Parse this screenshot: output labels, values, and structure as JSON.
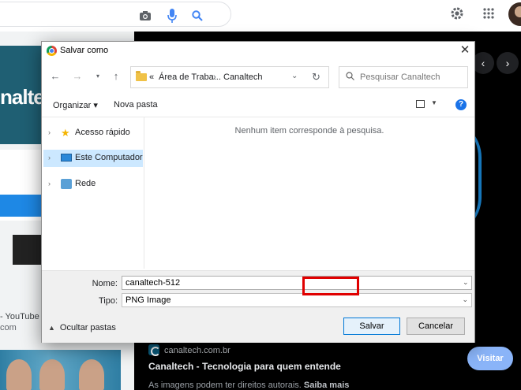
{
  "browser": {
    "left_caption_1": "- YouTube",
    "left_caption_2": "com",
    "tile_brand_text": "nalte"
  },
  "result": {
    "site_domain": "canaltech.com.br",
    "site_title": "Canaltech - Tecnologia para quem entende",
    "note_text": "As imagens podem ter direitos autorais.",
    "note_link": "Saiba mais",
    "visit_label": "Visitar"
  },
  "dialog": {
    "title": "Salvar como",
    "breadcrumb": {
      "overflow": "«",
      "items": [
        "Área de Traba...",
        "Canaltech"
      ]
    },
    "search_placeholder": "Pesquisar Canaltech",
    "toolbar": {
      "organize_label": "Organizar ▾",
      "new_folder_label": "Nova pasta"
    },
    "tree": [
      {
        "label": "Acesso rápido",
        "icon": "star-icon"
      },
      {
        "label": "Este Computador",
        "icon": "computer-icon",
        "selected": true
      },
      {
        "label": "Rede",
        "icon": "network-icon"
      }
    ],
    "empty_message": "Nenhum item corresponde à pesquisa.",
    "filename_label": "Nome:",
    "filename_value": "canaltech-512",
    "filetype_label": "Tipo:",
    "filetype_value": "PNG Image",
    "hide_folders_label": "Ocultar pastas",
    "save_label": "Salvar",
    "cancel_label": "Cancelar"
  },
  "colors": {
    "highlight": "#e00000",
    "selection": "#cce8ff",
    "visit_button": "#8ab4f8"
  }
}
